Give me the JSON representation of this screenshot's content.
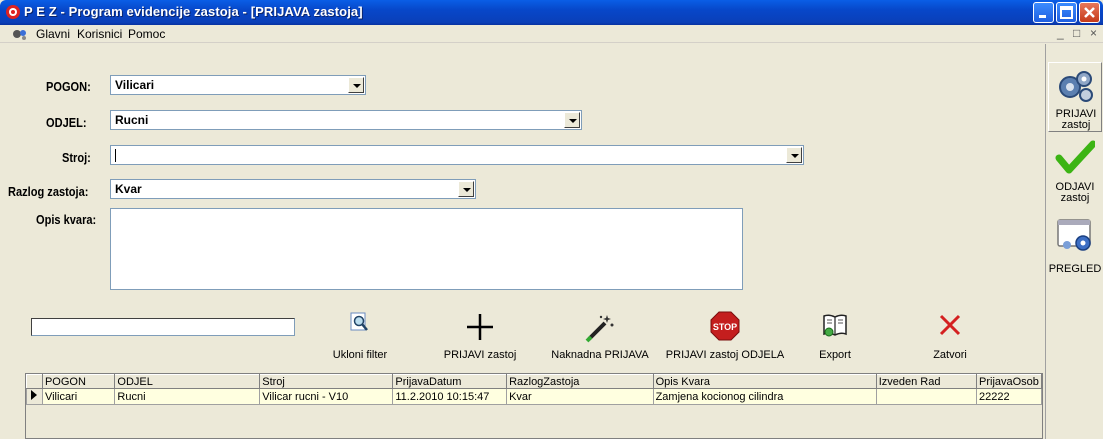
{
  "window": {
    "title": "P E Z - Program evidencije zastoja - [PRIJAVA zastoja]"
  },
  "menu": {
    "items": [
      "Glavni",
      "Korisnici",
      "Pomoc"
    ],
    "mdi_controls": [
      "_",
      "̅❒",
      "×"
    ]
  },
  "form": {
    "pogon": {
      "label": "POGON:",
      "value": "Vilicari"
    },
    "odjel": {
      "label": "ODJEL:",
      "value": "Rucni"
    },
    "stroj": {
      "label": "Stroj:",
      "value": ""
    },
    "razlog": {
      "label": "Razlog zastoja:",
      "value": "Kvar"
    },
    "opis": {
      "label": "Opis kvara:",
      "value": ""
    }
  },
  "toolbar": {
    "filter_value": "",
    "buttons": [
      {
        "label": "Ukloni filter",
        "icon": "search-icon"
      },
      {
        "label": "PRIJAVI zastoj",
        "icon": "plus-icon"
      },
      {
        "label": "Naknadna PRIJAVA",
        "icon": "magic-wand-icon"
      },
      {
        "label": "PRIJAVI zastoj ODJELA",
        "icon": "stop-sign-icon"
      },
      {
        "label": "Export",
        "icon": "book-icon"
      },
      {
        "label": "Zatvori",
        "icon": "close-icon"
      }
    ],
    "stop_text": "STOP"
  },
  "grid": {
    "columns": [
      "POGON",
      "ODJEL",
      "Stroj",
      "PrijavaDatum",
      "RazlogZastoja",
      "Opis Kvara",
      "Izveden Rad",
      "PrijavaOsob"
    ],
    "rows": [
      [
        "Vilicari",
        "Rucni",
        "Vilicar rucni - V10",
        "11.2.2010 10:15:47",
        "Kvar",
        "Zamjena kocionog cilindra",
        "",
        "22222"
      ]
    ]
  },
  "sidebar": {
    "items": [
      {
        "line1": "PRIJAVI",
        "line2": "zastoj",
        "icon": "gears-icon"
      },
      {
        "line1": "ODJAVI",
        "line2": "zastoj",
        "icon": "checkmark-icon"
      },
      {
        "line1": "PREGLED",
        "line2": "",
        "icon": "settings-window-icon"
      }
    ]
  },
  "colors": {
    "titlebar": "#0747c9",
    "grid_row": "#ffffe0",
    "stop": "#c41e1e",
    "close_x": "#d42020",
    "checkmark": "#3cb414"
  }
}
